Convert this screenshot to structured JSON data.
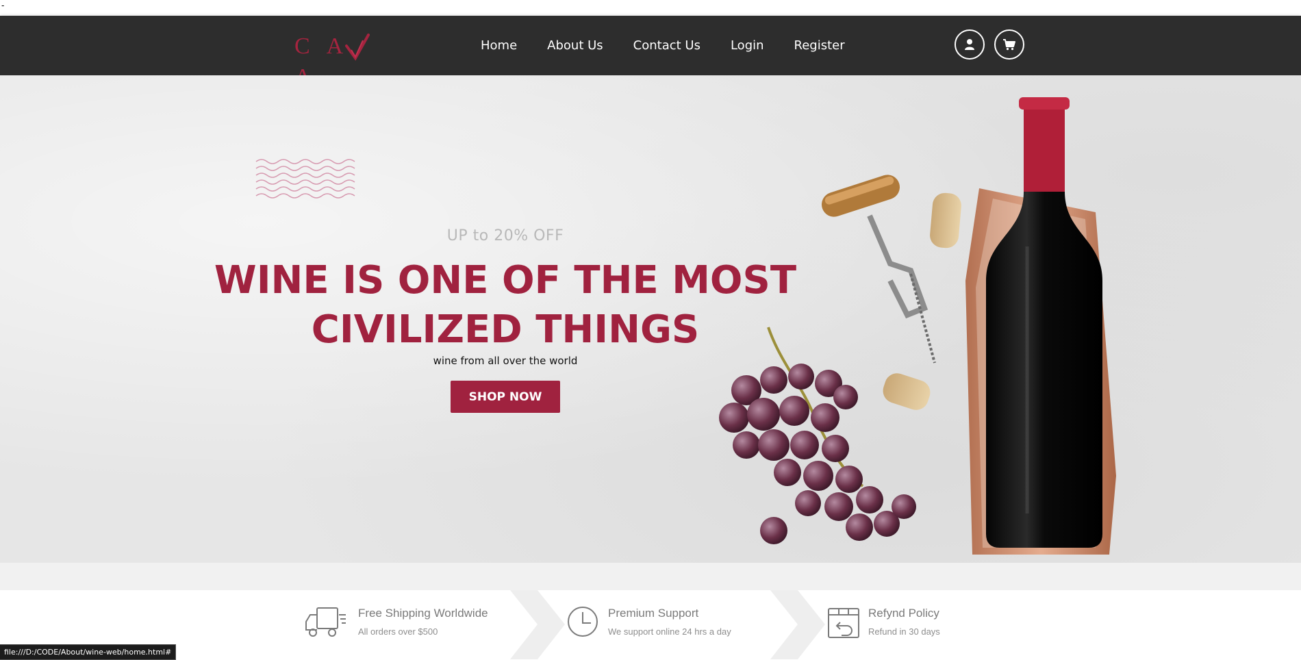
{
  "topbar": {
    "dash": "-"
  },
  "brand": {
    "logo_text": "CA A",
    "logo_alt": "CAVA"
  },
  "nav": {
    "links": [
      "Home",
      "About Us",
      "Contact Us",
      "Login",
      "Register"
    ],
    "user_icon": "user-icon",
    "cart_icon": "cart-icon"
  },
  "hero": {
    "offer": "UP to 20% OFF",
    "headline": "WINE IS ONE OF THE MOST CIVILIZED THINGS",
    "subline": "wine from all over the world",
    "cta": "SHOP NOW"
  },
  "features": [
    {
      "icon": "delivery-truck-icon",
      "title": "Free Shipping Worldwide",
      "subtitle": "All orders over $500"
    },
    {
      "icon": "clock-icon",
      "title": "Premium Support",
      "subtitle": "We support online 24 hrs a day"
    },
    {
      "icon": "refund-box-icon",
      "title": "Refynd Policy",
      "subtitle": "Refund in 30 days"
    }
  ],
  "status_bar": {
    "url": "file:///D:/CODE/About/wine-web/home.html#"
  },
  "colors": {
    "brand": "#a0223f",
    "navbar": "#2d2d2d",
    "hero_bg": "#e6e6e6"
  }
}
